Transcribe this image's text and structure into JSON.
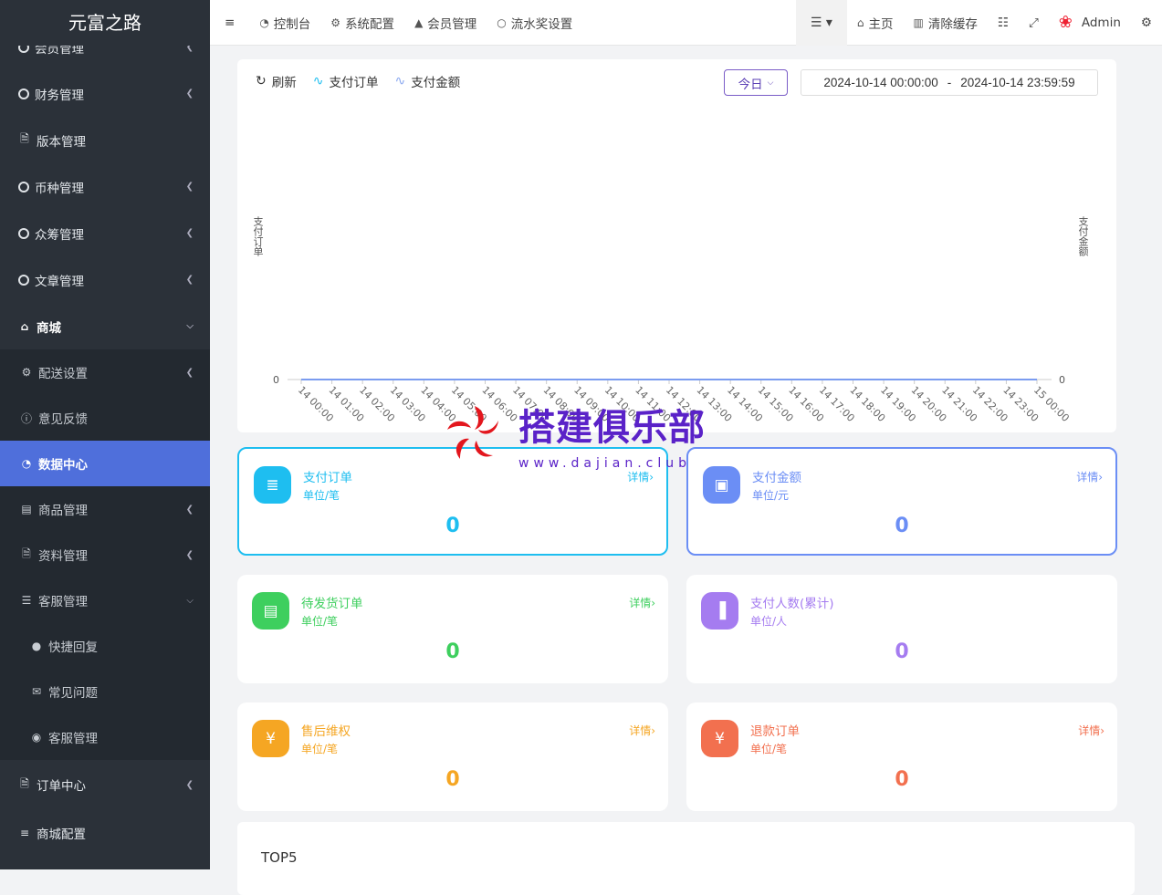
{
  "app_title": "元富之路",
  "sidebar": {
    "items": [
      {
        "label": "会员管理",
        "icon": "circle-icon"
      },
      {
        "label": "财务管理",
        "icon": "circle-icon"
      },
      {
        "label": "版本管理",
        "icon": "file-icon"
      },
      {
        "label": "币种管理",
        "icon": "circle-icon"
      },
      {
        "label": "众筹管理",
        "icon": "circle-icon"
      },
      {
        "label": "文章管理",
        "icon": "circle-icon"
      },
      {
        "label": "商城",
        "icon": "home-icon"
      }
    ],
    "shop_sub": [
      {
        "label": "配送设置"
      },
      {
        "label": "意见反馈"
      },
      {
        "label": "数据中心"
      },
      {
        "label": "商品管理"
      },
      {
        "label": "资料管理"
      },
      {
        "label": "客服管理"
      }
    ],
    "service_sub": [
      {
        "label": "快捷回复"
      },
      {
        "label": "常见问题"
      },
      {
        "label": "客服管理"
      }
    ],
    "more": [
      {
        "label": "订单中心"
      },
      {
        "label": "商城配置"
      }
    ]
  },
  "topbar": {
    "tabs": [
      {
        "label": "控制台"
      },
      {
        "label": "系统配置"
      },
      {
        "label": "会员管理"
      },
      {
        "label": "流水奖设置"
      }
    ],
    "home": "主页",
    "clear_cache": "清除缓存",
    "user": "Admin"
  },
  "toolbar": {
    "refresh": "刷新",
    "legend_orders": "支付订单",
    "legend_amount": "支付金额"
  },
  "date": {
    "preset": "今日",
    "start": "2024-10-14 00:00:00",
    "sep": "-",
    "end": "2024-10-14 23:59:59"
  },
  "chart_data": {
    "type": "line",
    "ylabel": "支付订单",
    "y2label": "支付金额",
    "categories": [
      "14 00:00",
      "14 01:00",
      "14 02:00",
      "14 03:00",
      "14 04:00",
      "14 05:00",
      "14 06:00",
      "14 07:00",
      "14 08:00",
      "14 09:00",
      "14 10:00",
      "14 11:00",
      "14 12:00",
      "14 13:00",
      "14 14:00",
      "14 15:00",
      "14 16:00",
      "14 17:00",
      "14 18:00",
      "14 19:00",
      "14 20:00",
      "14 21:00",
      "14 22:00",
      "14 23:00",
      "15 00:00"
    ],
    "series": [
      {
        "name": "支付订单",
        "values": [
          0,
          0,
          0,
          0,
          0,
          0,
          0,
          0,
          0,
          0,
          0,
          0,
          0,
          0,
          0,
          0,
          0,
          0,
          0,
          0,
          0,
          0,
          0,
          0,
          0
        ]
      },
      {
        "name": "支付金额",
        "values": [
          0,
          0,
          0,
          0,
          0,
          0,
          0,
          0,
          0,
          0,
          0,
          0,
          0,
          0,
          0,
          0,
          0,
          0,
          0,
          0,
          0,
          0,
          0,
          0,
          0
        ]
      }
    ],
    "y_tick": "0",
    "y2_tick": "0"
  },
  "cards": [
    {
      "title": "支付订单",
      "unit": "单位/笔",
      "detail": "详情›",
      "value": "0",
      "color": "#1ebef0"
    },
    {
      "title": "支付金额",
      "unit": "单位/元",
      "detail": "详情›",
      "value": "0",
      "color": "#6b8ef5"
    },
    {
      "title": "待发货订单",
      "unit": "单位/笔",
      "detail": "详情›",
      "value": "0",
      "color": "#3ecf5e"
    },
    {
      "title": "支付人数(累计)",
      "unit": "单位/人",
      "detail": "",
      "value": "0",
      "color": "#a57cf0"
    },
    {
      "title": "售后维权",
      "unit": "单位/笔",
      "detail": "详情›",
      "value": "0",
      "color": "#f5a623"
    },
    {
      "title": "退款订单",
      "unit": "单位/笔",
      "detail": "详情›",
      "value": "0",
      "color": "#f2704f"
    }
  ],
  "top5": "TOP5",
  "watermark": {
    "text": "搭建俱乐部",
    "url": "www.dajian.club"
  }
}
